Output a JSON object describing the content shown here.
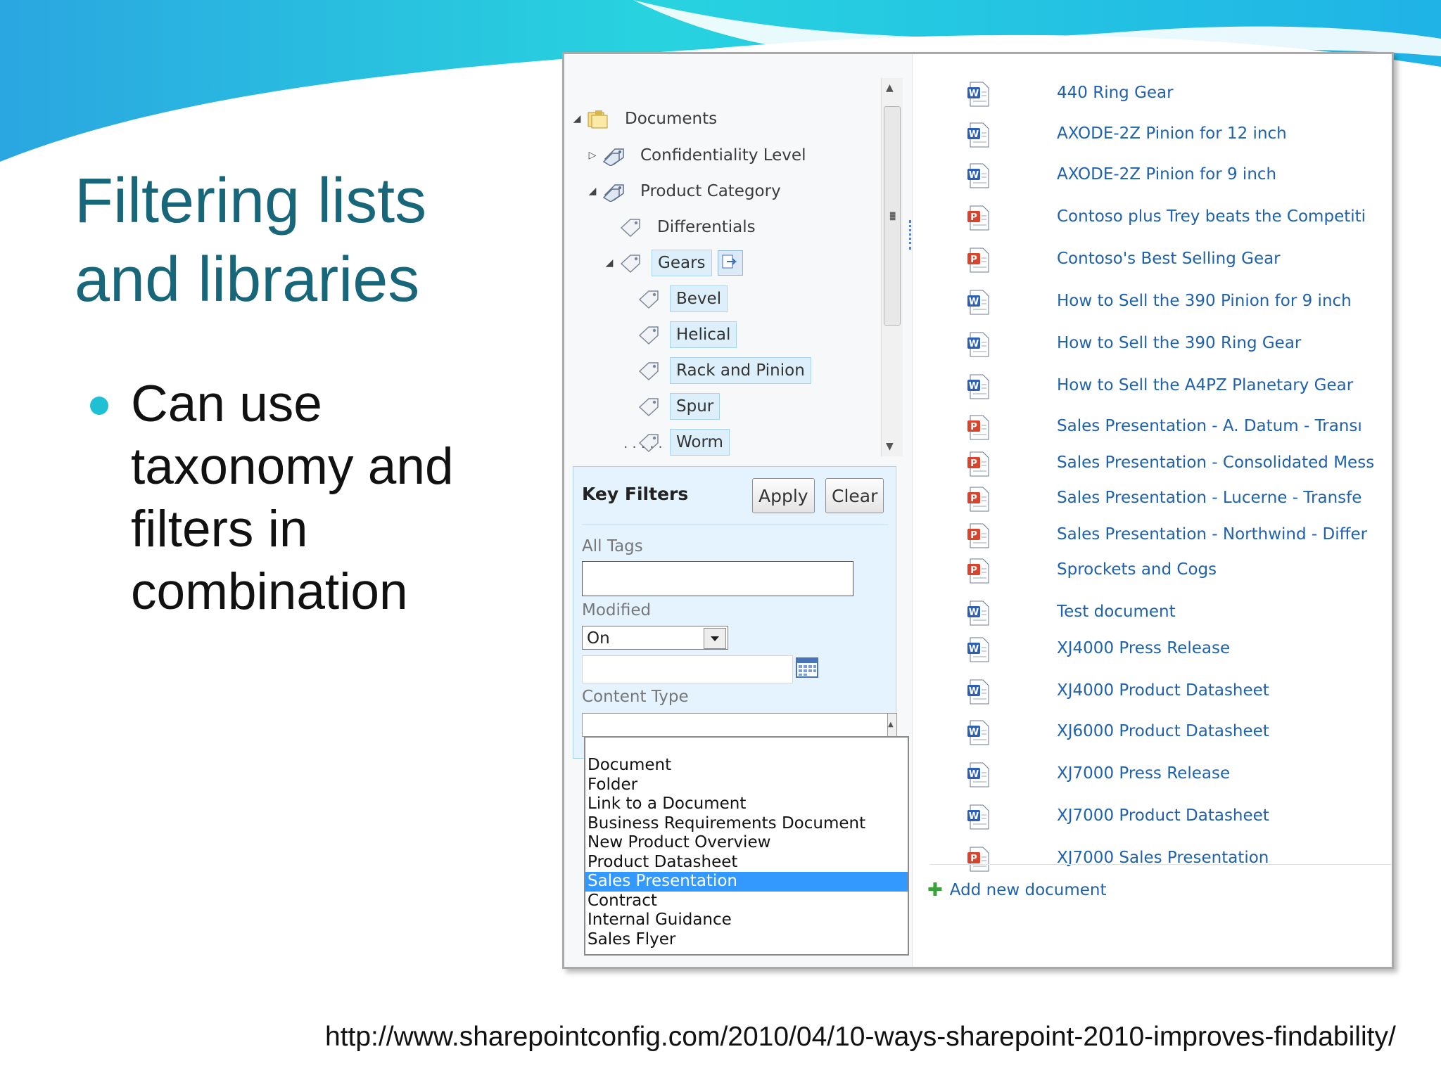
{
  "slide": {
    "title": "Filtering lists and libraries",
    "bullet": "Can use taxonomy and filters in combination",
    "source_url": "http://www.sharepointconfig.com/2010/04/10-ways-sharepoint-2010-improves-findability/"
  },
  "tree": {
    "nodes": [
      {
        "id": "documents",
        "label": "Documents",
        "icon": "folder-library-icon",
        "expander": "expanded",
        "selected": false
      },
      {
        "id": "confidentiality",
        "label": "Confidentiality Level",
        "icon": "metadata-field-icon",
        "expander": "collapsed",
        "selected": false
      },
      {
        "id": "product-category",
        "label": "Product Category",
        "icon": "metadata-field-icon",
        "expander": "expanded",
        "selected": false
      },
      {
        "id": "differentials",
        "label": "Differentials",
        "icon": "tag-icon",
        "expander": "none",
        "selected": false
      },
      {
        "id": "gears",
        "label": "Gears",
        "icon": "tag-icon",
        "expander": "expanded",
        "selected": true
      },
      {
        "id": "bevel",
        "label": "Bevel",
        "icon": "tag-icon",
        "expander": "none",
        "selected": true
      },
      {
        "id": "helical",
        "label": "Helical",
        "icon": "tag-icon",
        "expander": "none",
        "selected": true
      },
      {
        "id": "rack-and-pinion",
        "label": "Rack and Pinion",
        "icon": "tag-icon",
        "expander": "none",
        "selected": true
      },
      {
        "id": "spur",
        "label": "Spur",
        "icon": "tag-icon",
        "expander": "none",
        "selected": true
      },
      {
        "id": "worm",
        "label": "Worm",
        "icon": "tag-icon",
        "expander": "none",
        "selected": true
      }
    ],
    "truncated_text": "....."
  },
  "key_filters": {
    "title": "Key Filters",
    "apply": "Apply",
    "clear": "Clear",
    "all_tags_label": "All Tags",
    "all_tags_value": "",
    "modified_label": "Modified",
    "modified_operator": "On",
    "modified_date": "",
    "content_type_label": "Content Type",
    "content_type_value": ""
  },
  "content_types": {
    "options": [
      "Document",
      "Folder",
      "Link to a Document",
      "Business Requirements Document",
      "New Product Overview",
      "Product Datasheet",
      "Sales Presentation",
      "Contract",
      "Internal Guidance",
      "Sales Flyer"
    ],
    "selected": "Sales Presentation"
  },
  "documents": [
    {
      "title": "440 Ring Gear",
      "type": "word"
    },
    {
      "title": "AXODE-2Z Pinion for 12 inch",
      "type": "word"
    },
    {
      "title": "AXODE-2Z Pinion for 9 inch",
      "type": "word"
    },
    {
      "title": "Contoso plus Trey beats the Competiti",
      "type": "powerpoint"
    },
    {
      "title": "Contoso's Best Selling Gear",
      "type": "powerpoint"
    },
    {
      "title": "How to Sell the 390 Pinion for 9 inch",
      "type": "word"
    },
    {
      "title": "How to Sell the 390 Ring Gear",
      "type": "word"
    },
    {
      "title": "How to Sell the A4PZ Planetary Gear",
      "type": "word"
    },
    {
      "title": "Sales Presentation - A. Datum - Transı",
      "type": "powerpoint"
    },
    {
      "title": "Sales Presentation - Consolidated Mess",
      "type": "powerpoint"
    },
    {
      "title": "Sales Presentation - Lucerne - Transfe",
      "type": "powerpoint"
    },
    {
      "title": "Sales Presentation - Northwind - Differ",
      "type": "powerpoint"
    },
    {
      "title": "Sprockets and Cogs",
      "type": "powerpoint"
    },
    {
      "title": "Test document",
      "type": "word"
    },
    {
      "title": "XJ4000 Press Release",
      "type": "word"
    },
    {
      "title": "XJ4000 Product Datasheet",
      "type": "word"
    },
    {
      "title": "XJ6000 Product Datasheet",
      "type": "word"
    },
    {
      "title": "XJ7000 Press Release",
      "type": "word"
    },
    {
      "title": "XJ7000 Product Datasheet",
      "type": "word"
    },
    {
      "title": "XJ7000 Sales Presentation",
      "type": "powerpoint"
    }
  ],
  "add_new_document": "Add new document",
  "colors": {
    "title": "#17667a",
    "link": "#1f61ad",
    "accent": "#1fc0d4",
    "selected_option": "#3399ff",
    "tag_selected": "#ddeffa"
  }
}
